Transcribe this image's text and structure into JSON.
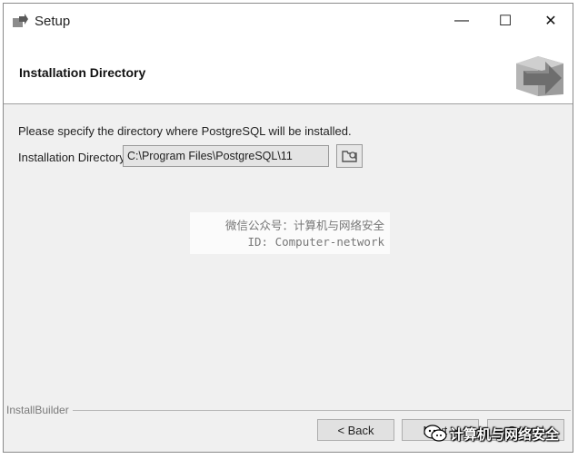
{
  "window": {
    "title": "Setup",
    "controls": {
      "minimize": "—",
      "maximize": "☐",
      "close": "✕"
    }
  },
  "header": {
    "title": "Installation Directory",
    "logo_icon": "setup-box-arrow-icon"
  },
  "content": {
    "description": "Please specify the directory where PostgreSQL will be installed.",
    "directory_label": "Installation Directory",
    "directory_value": "C:\\Program Files\\PostgreSQL\\11",
    "browse_icon": "folder-browse-icon"
  },
  "watermark": {
    "line1": "微信公众号：计算机与网络安全",
    "line2": "ID: Computer-network"
  },
  "footer": {
    "brand": "InstallBuilder",
    "back_label": "< Back",
    "next_label": "Next >",
    "cancel_label": "Cancel"
  },
  "overlay_mark": {
    "text": "计算机与网络安全",
    "icon": "wechat-icon"
  },
  "colors": {
    "window_bg": "#f0f0f0",
    "header_bg": "#ffffff",
    "button_bg": "#e1e1e1",
    "logo_arrow": "#6e6e6e"
  }
}
